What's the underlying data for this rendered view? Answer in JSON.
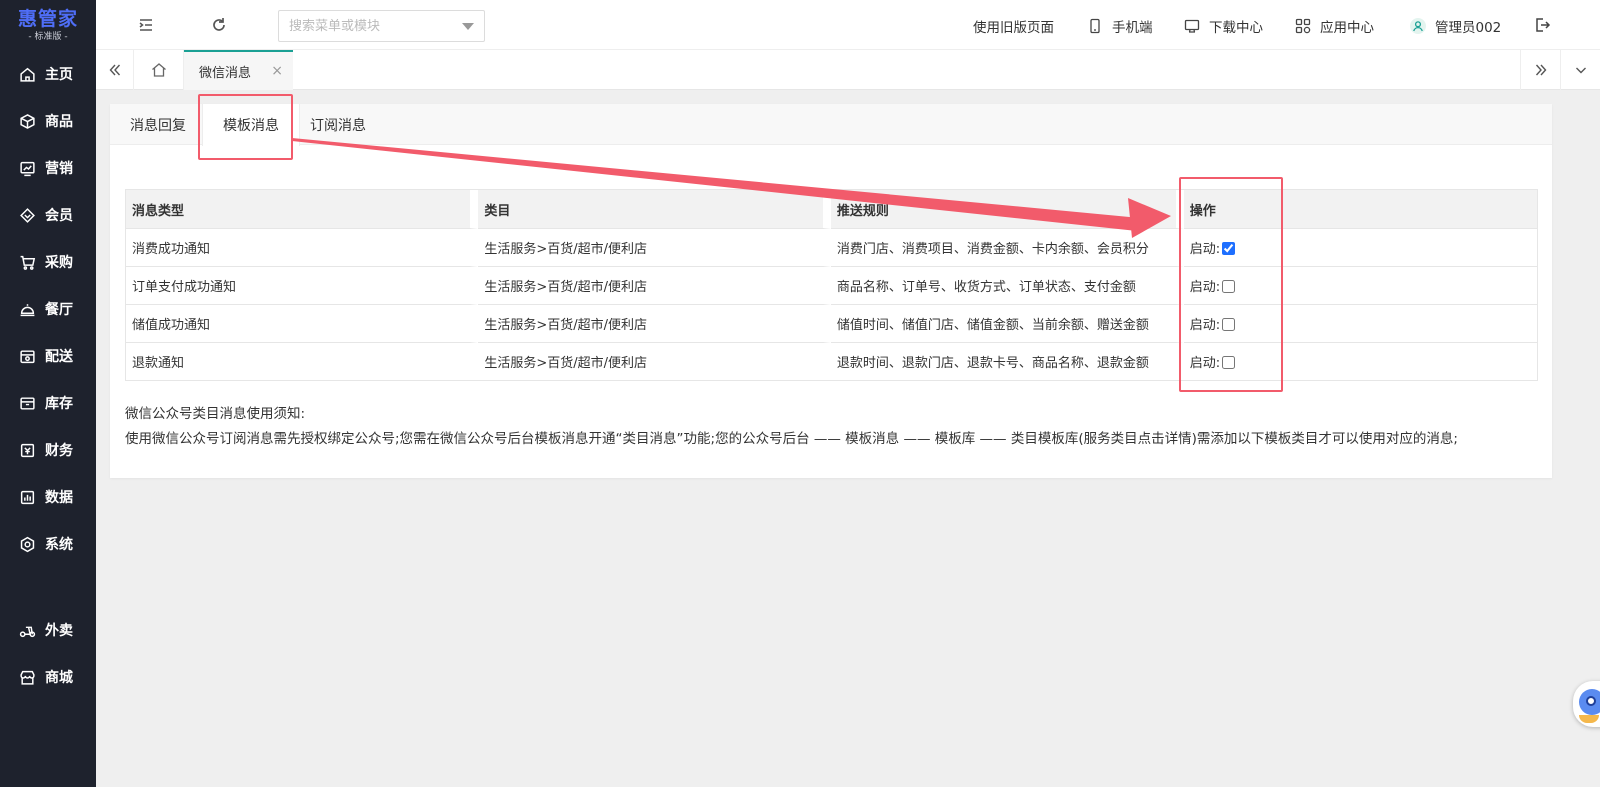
{
  "brand": {
    "name": "惠管家",
    "edition": "标准版",
    "color": "#4f6ef7"
  },
  "sidebar": {
    "items": [
      {
        "label": "主页",
        "icon": "home-icon"
      },
      {
        "label": "商品",
        "icon": "cube-icon"
      },
      {
        "label": "营销",
        "icon": "chart-icon"
      },
      {
        "label": "会员",
        "icon": "diamond-icon"
      },
      {
        "label": "采购",
        "icon": "cart-icon"
      },
      {
        "label": "餐厅",
        "icon": "cloche-icon"
      },
      {
        "label": "配送",
        "icon": "delivery-icon"
      },
      {
        "label": "库存",
        "icon": "box-icon"
      },
      {
        "label": "财务",
        "icon": "finance-icon"
      },
      {
        "label": "数据",
        "icon": "data-icon"
      },
      {
        "label": "系统",
        "icon": "settings-icon"
      },
      {
        "label": "外卖",
        "icon": "scooter-icon"
      },
      {
        "label": "商城",
        "icon": "store-icon"
      }
    ]
  },
  "header": {
    "search_placeholder": "搜索菜单或模块",
    "old_version": "使用旧版页面",
    "mobile": "手机端",
    "download": "下载中心",
    "apps": "应用中心",
    "user": "管理员002"
  },
  "tabs": {
    "active": "微信消息",
    "close": "×"
  },
  "subtabs": [
    "消息回复",
    "模板消息",
    "订阅消息"
  ],
  "table": {
    "headers": [
      "消息类型",
      "类目",
      "推送规则",
      "操作"
    ],
    "rows": [
      {
        "type": "消费成功通知",
        "category": "生活服务>百货/超市/便利店",
        "rule": "消费门店、消费项目、消费金额、卡内余额、会员积分",
        "action": "启动:",
        "enabled": true
      },
      {
        "type": "订单支付成功通知",
        "category": "生活服务>百货/超市/便利店",
        "rule": "商品名称、订单号、收货方式、订单状态、支付金额",
        "action": "启动:",
        "enabled": false
      },
      {
        "type": "储值成功通知",
        "category": "生活服务>百货/超市/便利店",
        "rule": "储值时间、储值门店、储值金额、当前余额、赠送金额",
        "action": "启动:",
        "enabled": false
      },
      {
        "type": "退款通知",
        "category": "生活服务>百货/超市/便利店",
        "rule": "退款时间、退款门店、退款卡号、商品名称、退款金额",
        "action": "启动:",
        "enabled": false
      }
    ]
  },
  "notice": {
    "title": "微信公众号类目消息使用须知:",
    "text": "使用微信公众号订阅消息需先授权绑定公众号;您需在微信公众号后台模板消息开通“类目消息”功能;您的公众号后台 —— 模板消息 —— 模板库 —— 类目模板库(服务类目点击详情)需添加以下模板类目才可以使用对应的消息;"
  },
  "colors": {
    "sidebar_bg": "#1e222d",
    "tab_accent": "#1aa094",
    "annotation": "#f25b6b"
  }
}
